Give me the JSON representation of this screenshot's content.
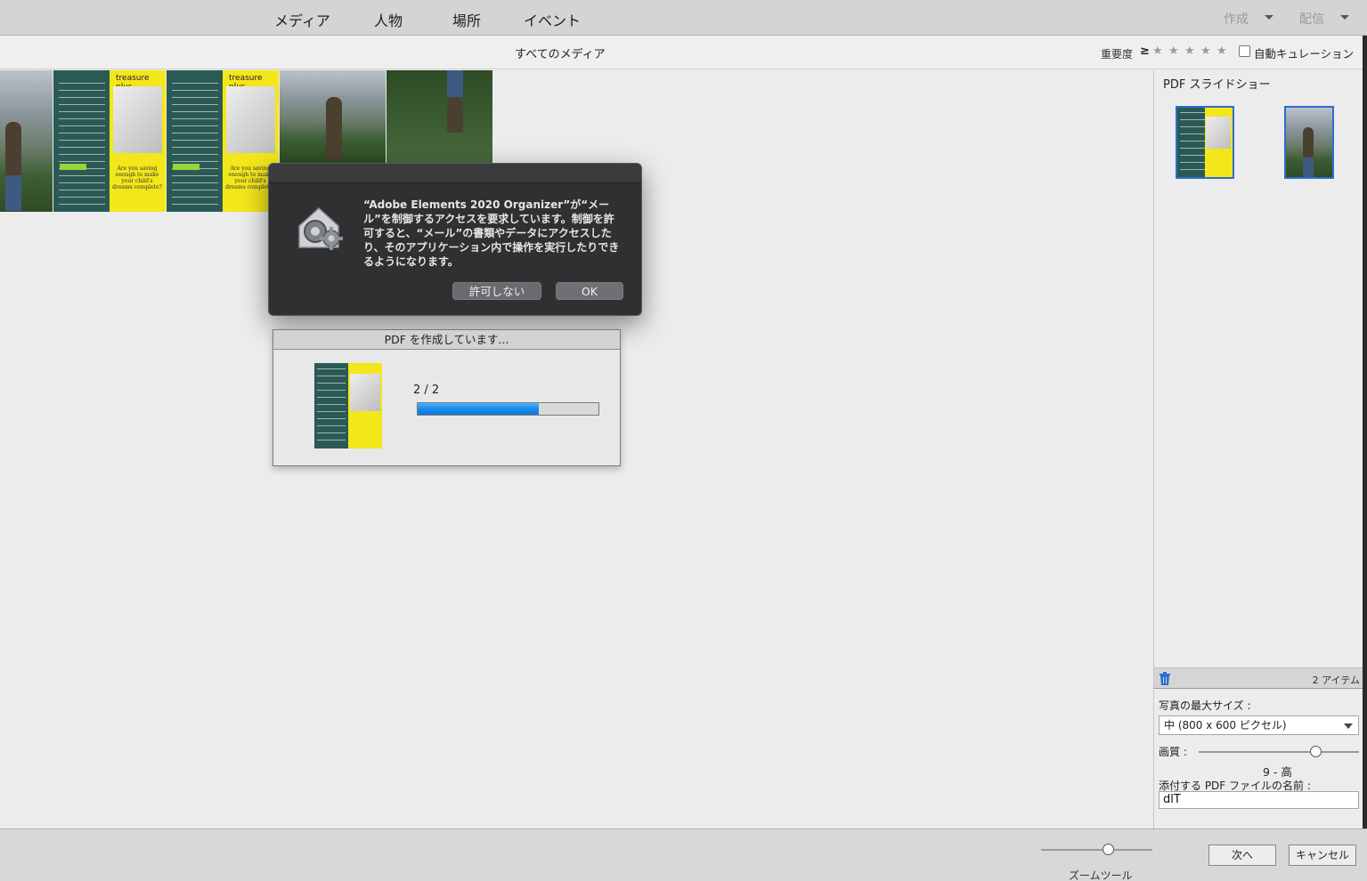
{
  "nav": {
    "items": [
      "メディア",
      "人物",
      "場所",
      "イベント"
    ],
    "create_label": "作成",
    "share_label": "配信"
  },
  "subbar": {
    "title": "すべてのメディア",
    "rating_label": "重要度",
    "rating_operator": "≥",
    "stars": [
      "★",
      "★",
      "★",
      "★",
      "★"
    ],
    "auto_curate_label": "自動キュレーション",
    "auto_curate_checked": false
  },
  "grid": {
    "flyer_brand": "treasure plus",
    "flyer_slogan": "Are you saving enough to make your child's dreams complete?"
  },
  "permission_dialog": {
    "message": "“Adobe Elements 2020 Organizer”が“メール”を制御するアクセスを要求しています。制御を許可すると、“メール”の書類やデータにアクセスしたり、そのアプリケーション内で操作を実行したりできるようになります。",
    "deny_label": "許可しない",
    "ok_label": "OK"
  },
  "progress_dialog": {
    "title": "PDF を作成しています...",
    "count": "2 / 2",
    "progress_fraction": 0.67
  },
  "right_panel": {
    "title": "PDF スライドショー",
    "item_count": "2 アイテム",
    "max_size_label": "写真の最大サイズ :",
    "max_size_value": "中 (800 x 600 ピクセル)",
    "quality_label": "画質 :",
    "quality_value": "9 - 高",
    "quality_fraction": 0.73,
    "filename_label": "添付する PDF ファイルの名前 :",
    "filename_value": "dlT"
  },
  "bottom": {
    "zoom_label": "ズームツール",
    "zoom_fraction": 0.6,
    "next_label": "次へ",
    "cancel_label": "キャンセル"
  },
  "colors": {
    "accent_blue": "#1a8aea",
    "selection_border": "#2b6fd0",
    "dialog_bg": "#2f3032",
    "flyer_green": "#2b5a55",
    "flyer_yellow": "#f3e61a"
  }
}
